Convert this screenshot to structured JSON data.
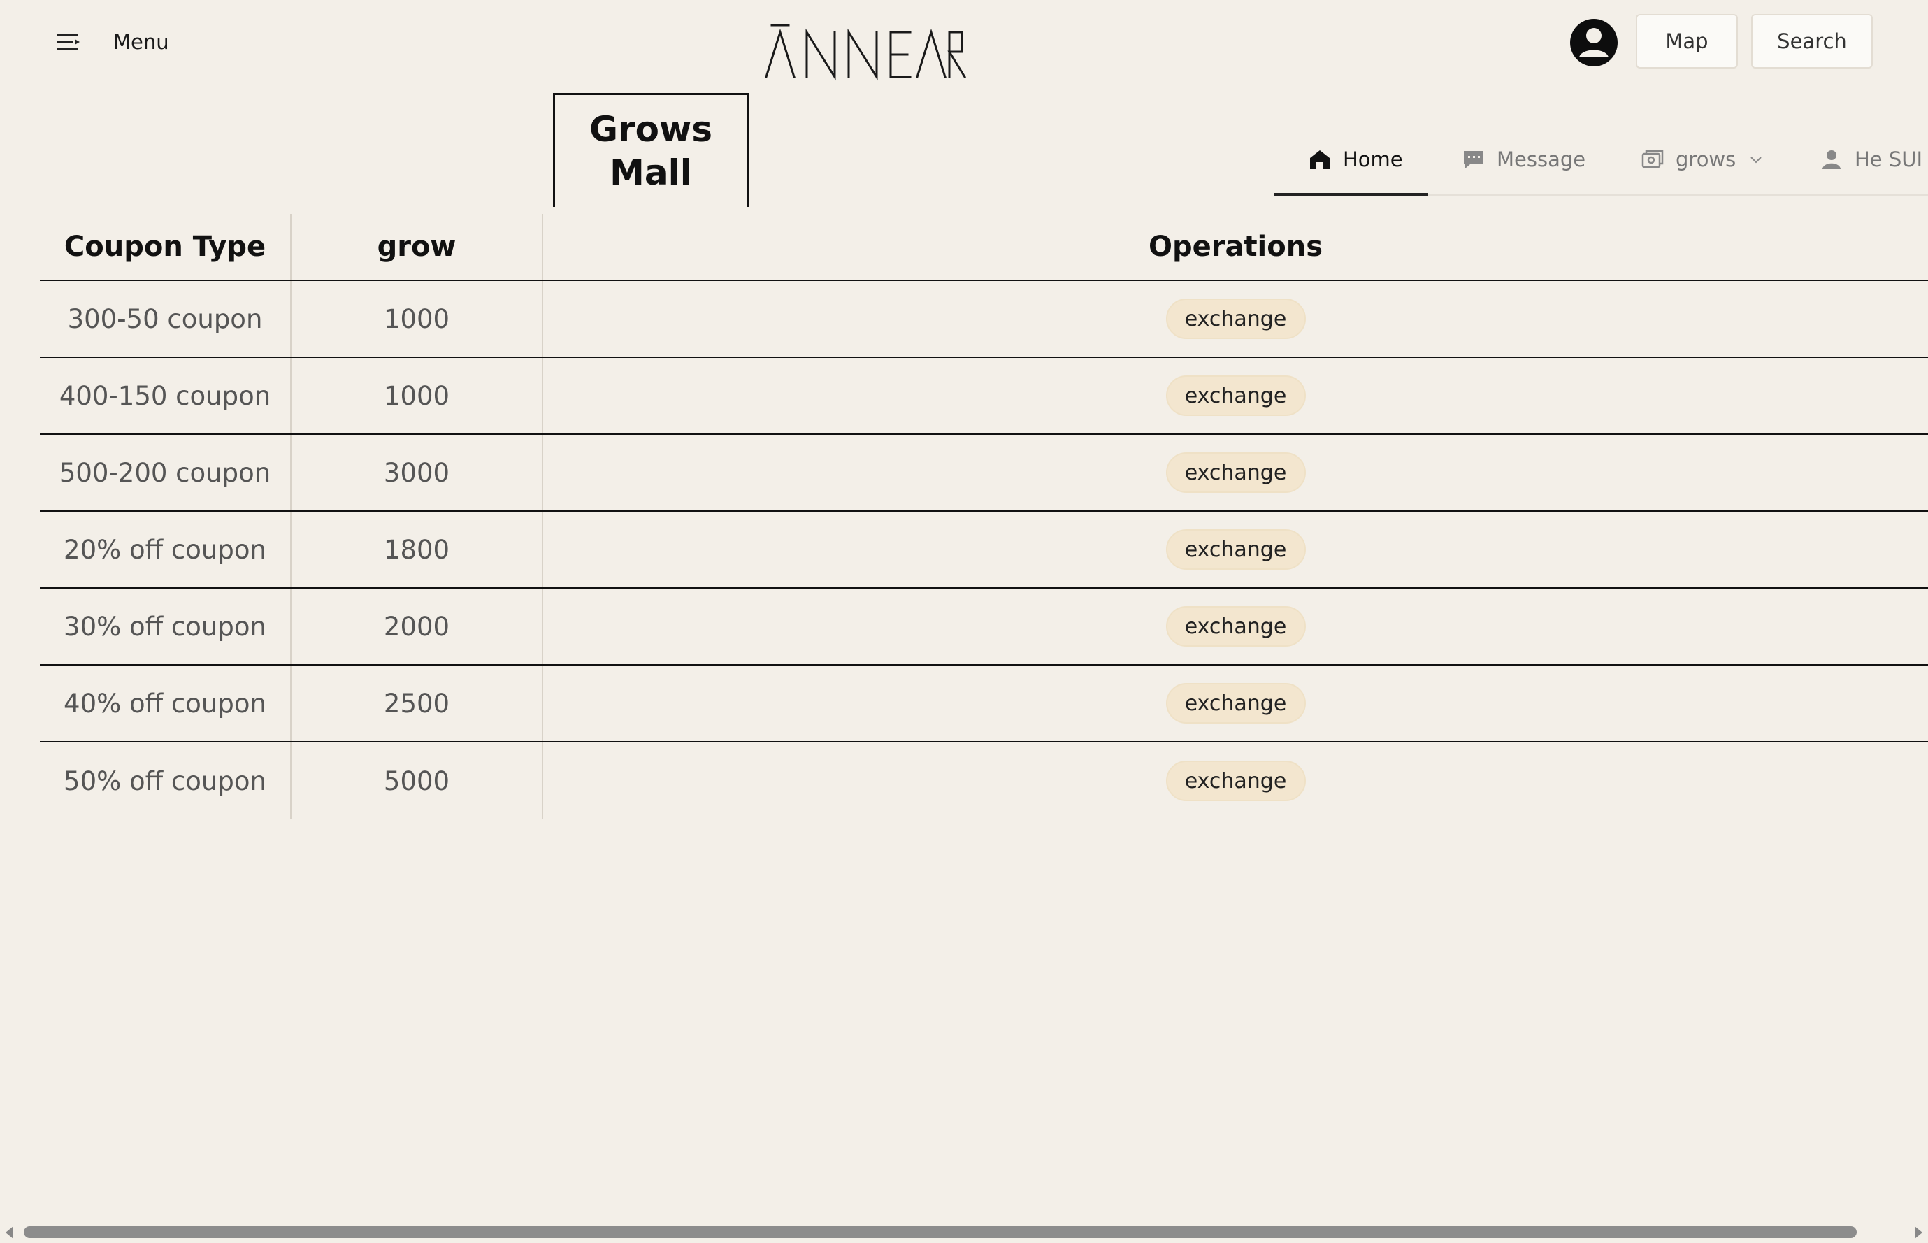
{
  "header": {
    "menu_label": "Menu",
    "logo_text": "ANNEAR",
    "map_button": "Map",
    "search_button": "Search"
  },
  "mall": {
    "title": "Grows Mall"
  },
  "nav": {
    "items": [
      {
        "label": "Home",
        "icon": "home-icon",
        "active": true
      },
      {
        "label": "Message",
        "icon": "message-icon",
        "active": false
      },
      {
        "label": "grows",
        "icon": "grows-icon",
        "active": false,
        "has_dropdown": true
      },
      {
        "label": "He SUI",
        "icon": "user-icon",
        "active": false
      }
    ]
  },
  "table": {
    "headers": [
      "Coupon Type",
      "grow",
      "Operations"
    ],
    "rows": [
      {
        "coupon": "300-50 coupon",
        "grow": "1000",
        "action": "exchange"
      },
      {
        "coupon": "400-150 coupon",
        "grow": "1000",
        "action": "exchange"
      },
      {
        "coupon": "500-200 coupon",
        "grow": "3000",
        "action": "exchange"
      },
      {
        "coupon": "20% off coupon",
        "grow": "1800",
        "action": "exchange"
      },
      {
        "coupon": "30% off coupon",
        "grow": "2000",
        "action": "exchange"
      },
      {
        "coupon": "40% off coupon",
        "grow": "2500",
        "action": "exchange"
      },
      {
        "coupon": "50% off coupon",
        "grow": "5000",
        "action": "exchange"
      }
    ]
  },
  "colors": {
    "background": "#f3efe8",
    "exchange_bg": "#f3e6cf",
    "text": "#111111",
    "muted_text": "#555555"
  }
}
